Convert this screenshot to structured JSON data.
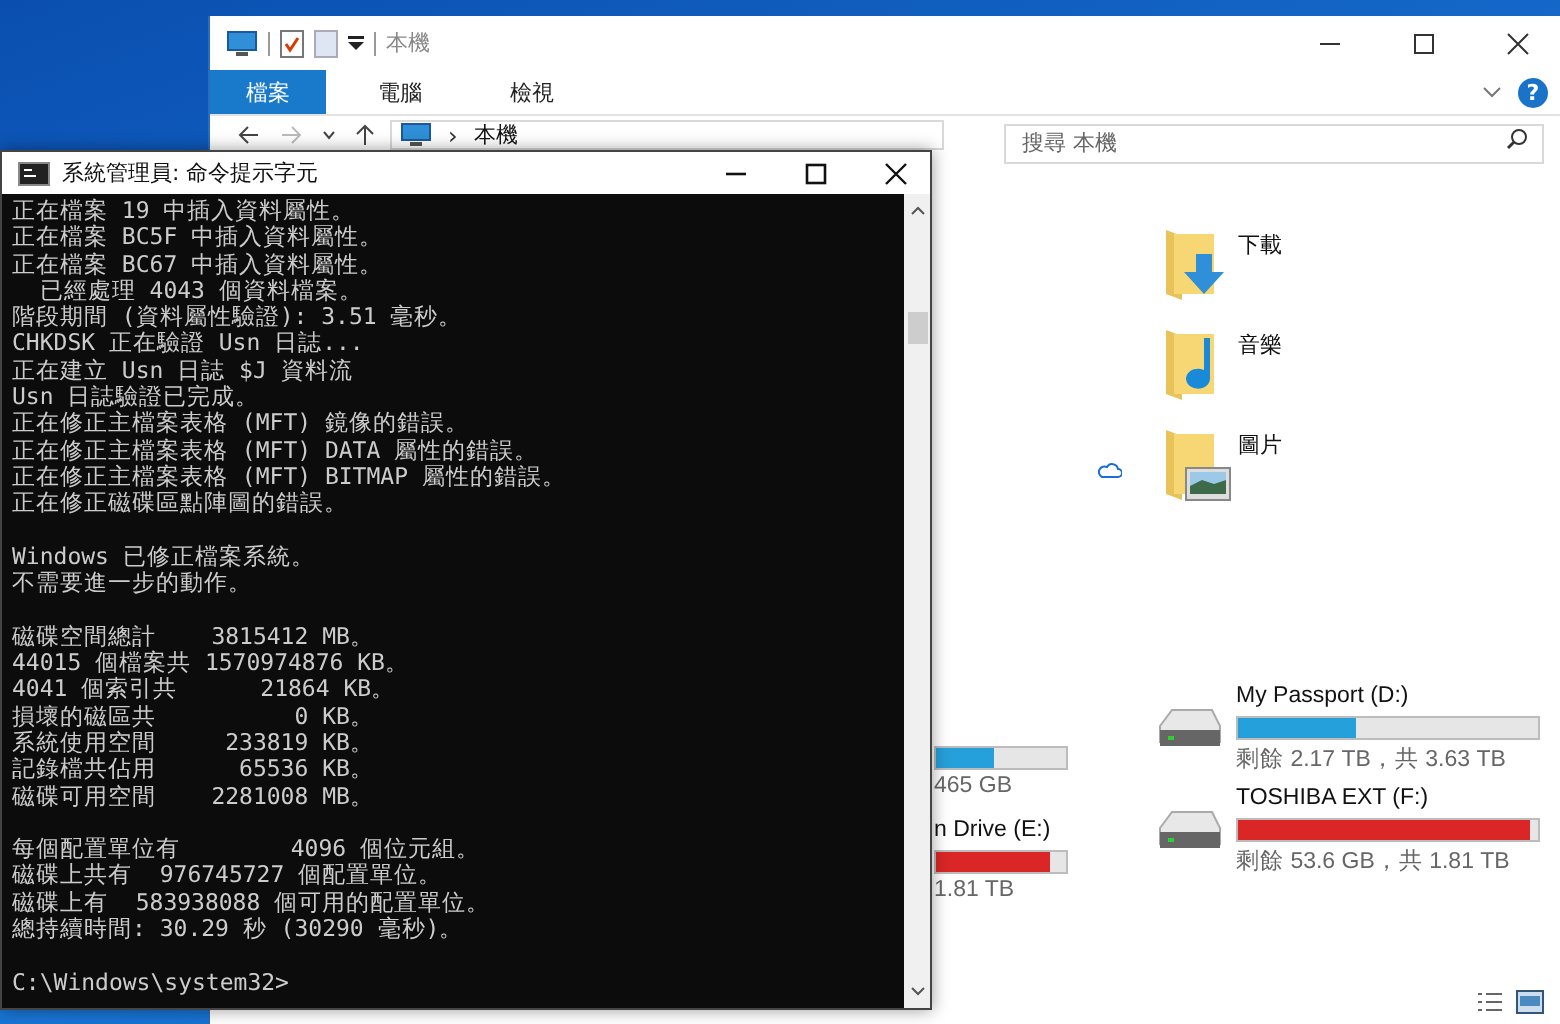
{
  "explorer": {
    "title": "本機",
    "tabs": [
      {
        "label": "檔案",
        "selected": true
      },
      {
        "label": "電腦",
        "selected": false
      },
      {
        "label": "檢視",
        "selected": false
      }
    ],
    "help": "?",
    "address": {
      "separator": "›",
      "location": "本機"
    },
    "search": {
      "placeholder": "搜尋 本機"
    },
    "folders": [
      {
        "label": "下載",
        "kind": "download"
      },
      {
        "label": "音樂",
        "kind": "music"
      },
      {
        "label": "圖片",
        "kind": "pictures"
      }
    ],
    "drives_left": [
      {
        "size": "465 GB",
        "level": 0.45,
        "color": "#26a0da"
      },
      {
        "name": "n Drive (E:)",
        "size": "1.81 TB",
        "level": 0.88,
        "color": "#da2626"
      }
    ],
    "drives_right": [
      {
        "name": "My Passport (D:)",
        "size": "剩餘 2.17 TB，共 3.63 TB",
        "level": 0.39,
        "color": "#26a0da"
      },
      {
        "name": "TOSHIBA EXT (F:)",
        "size": "剩餘 53.6 GB，共 1.81 TB",
        "level": 0.97,
        "color": "#da2626"
      }
    ]
  },
  "cmd": {
    "title": "系統管理員: 命令提示字元",
    "output": [
      [
        "正在檔案 19 中插入資料屬性。",
        "正在檔案 BC5F 中插入資料屬性。",
        "正在檔案 BC67 中插入資料屬性。",
        "  已經處理 4043 個資料檔案。",
        "階段期間 (資料屬性驗證): 3.51 毫秒。",
        "CHKDSK 正在驗證 Usn 日誌...",
        "正在建立 Usn 日誌 $J 資料流",
        "Usn 日誌驗證已完成。",
        "正在修正主檔案表格 (MFT) 鏡像的錯誤。",
        "正在修正主檔案表格 (MFT) DATA 屬性的錯誤。",
        "正在修正主檔案表格 (MFT) BITMAP 屬性的錯誤。",
        "正在修正磁碟區點陣圖的錯誤。"
      ],
      [
        "Windows 已修正檔案系統。",
        "不需要進一步的動作。"
      ],
      [
        "磁碟空間總計    3815412 MB。",
        "44015 個檔案共 1570974876 KB。",
        "4041 個索引共      21864 KB。",
        "損壞的磁區共          0 KB。",
        "系統使用空間     233819 KB。",
        "記錄檔共佔用      65536 KB。",
        "磁碟可用空間    2281008 MB。"
      ],
      [
        "每個配置單位有        4096 個位元組。",
        "磁碟上共有  976745727 個配置單位。",
        "磁碟上有  583938088 個可用的配置單位。",
        "總持續時間: 30.29 秒 (30290 毫秒)。"
      ],
      [
        "C:\\Windows\\system32>"
      ]
    ]
  }
}
